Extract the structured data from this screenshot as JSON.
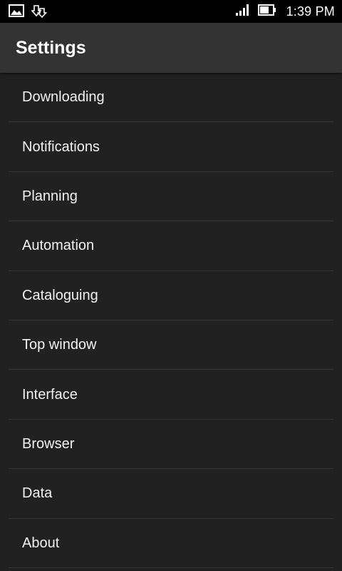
{
  "status_bar": {
    "time": "1:39 PM",
    "icons": [
      "image-notification-icon",
      "download-notification-icon",
      "signal-icon",
      "battery-icon"
    ]
  },
  "app_bar": {
    "title": "Settings"
  },
  "settings": {
    "items": [
      {
        "label": "Downloading"
      },
      {
        "label": "Notifications"
      },
      {
        "label": "Planning"
      },
      {
        "label": "Automation"
      },
      {
        "label": "Cataloguing"
      },
      {
        "label": "Top window"
      },
      {
        "label": "Interface"
      },
      {
        "label": "Browser"
      },
      {
        "label": "Data"
      },
      {
        "label": "About"
      }
    ]
  },
  "colors": {
    "background": "#212121",
    "app_bar": "#333333",
    "status_bar": "#000000",
    "divider": "#353535",
    "text": "#ffffff"
  }
}
